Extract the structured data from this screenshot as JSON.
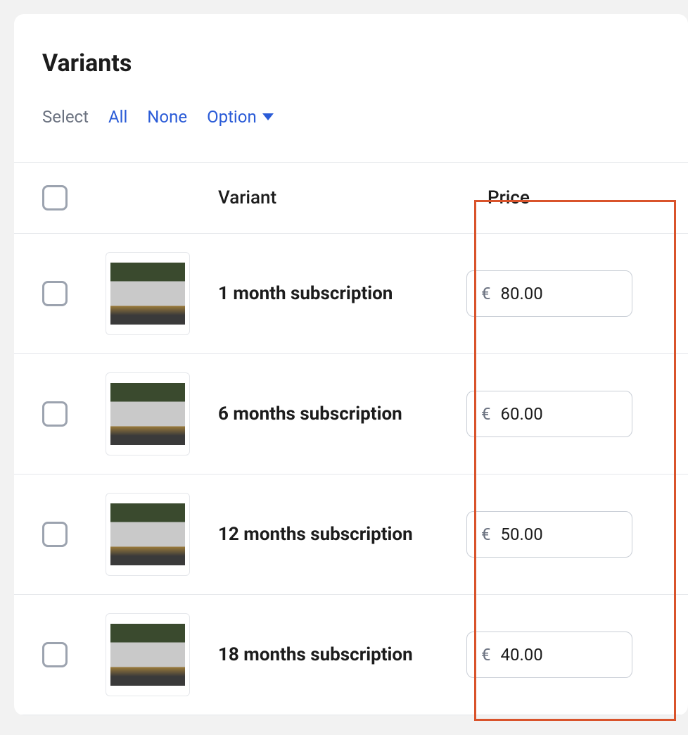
{
  "header": {
    "title": "Variants"
  },
  "select_bar": {
    "label": "Select",
    "all": "All",
    "none": "None",
    "option": "Option"
  },
  "table": {
    "head": {
      "variant": "Variant",
      "price": "Price"
    },
    "currency": "€",
    "rows": [
      {
        "name": "1 month subscription",
        "price": "80.00"
      },
      {
        "name": "6 months subscription",
        "price": "60.00"
      },
      {
        "name": "12 months subscription",
        "price": "50.00"
      },
      {
        "name": "18 months subscription",
        "price": "40.00"
      }
    ]
  }
}
